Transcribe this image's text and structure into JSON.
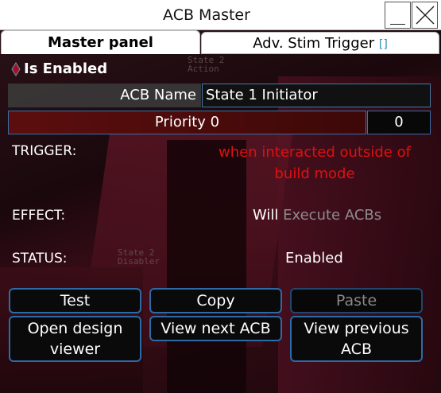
{
  "window": {
    "title": "ACB Master"
  },
  "tabs": [
    {
      "label": "Master panel",
      "active": true
    },
    {
      "label": "Adv. Stim Trigger",
      "suffix": "[]",
      "active": false
    }
  ],
  "enabled": {
    "label": "Is Enabled"
  },
  "name": {
    "label": "ACB Name",
    "value": "State 1 Initiator"
  },
  "priority": {
    "label": "Priority 0",
    "value": "0"
  },
  "trigger": {
    "label": "TRIGGER:",
    "value": "when interacted outside of build mode"
  },
  "effect": {
    "label": "EFFECT:",
    "value_prefix": "Will",
    "value_suffix": "Execute ACBs"
  },
  "status": {
    "label": "STATUS:",
    "value": "Enabled"
  },
  "buttons": {
    "test": "Test",
    "copy": "Copy",
    "paste": "Paste",
    "open_design_viewer": "Open design viewer",
    "view_next": "View next ACB",
    "view_previous": "View previous ACB"
  },
  "background_decals": {
    "state2_action": "State 2 Action",
    "state2_disabler": "State 2 Disabler"
  },
  "colors": {
    "accent_border": "#2d6aa8",
    "trigger_text": "#e01010",
    "priority_fill": "#5c0e0e"
  }
}
